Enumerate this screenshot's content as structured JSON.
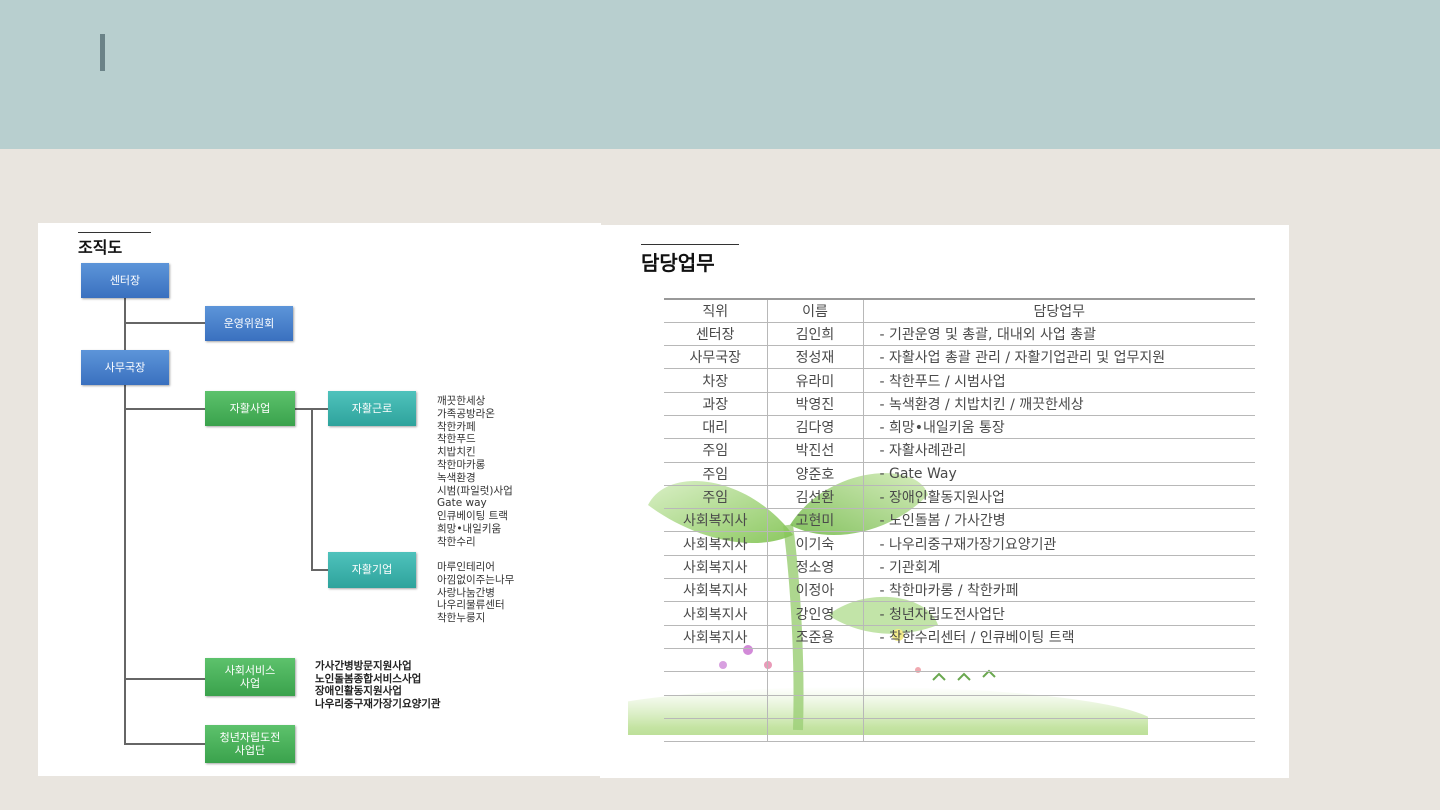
{
  "org": {
    "title": "조직도",
    "nodes": {
      "center_head": "센터장",
      "committee": "운영위원회",
      "secretary_general": "사무국장",
      "self_support": "자활사업",
      "self_work": "자활근로",
      "self_enterprise": "자활기업",
      "social_service": "사회서비스\n사업",
      "youth": "청년자립도전\n사업단"
    },
    "self_work_items": [
      "깨끗한세상",
      "가족공방라온",
      "착한카페",
      "착한푸드",
      "치밥치킨",
      "착한마카롱",
      "녹색환경",
      "시범(파일럿)사업",
      "Gate way",
      "인큐베이팅 트랙",
      "희망•내일키움",
      "착한수리"
    ],
    "enterprise_items": [
      "마루인테리어",
      "아낌없이주는나무",
      "사랑나눔간병",
      "나우리물류센터",
      "착한누룽지"
    ],
    "social_items": [
      "가사간병방문지원사업",
      "노인돌봄종합서비스사업",
      "장애인활동지원사업",
      "나우리중구재가장기요양기관"
    ]
  },
  "duty": {
    "title": "담당업무",
    "headers": [
      "직위",
      "이름",
      "담당업무"
    ],
    "rows": [
      [
        "센터장",
        "김인희",
        "- 기관운영 및 총괄, 대내외 사업 총괄"
      ],
      [
        "사무국장",
        "정성재",
        "- 자활사업 총괄 관리 / 자활기업관리 및 업무지원"
      ],
      [
        "차장",
        "유라미",
        "- 착한푸드 / 시범사업"
      ],
      [
        "과장",
        "박영진",
        "- 녹색환경 / 치밥치킨 / 깨끗한세상"
      ],
      [
        "대리",
        "김다영",
        "- 희망•내일키움 통장"
      ],
      [
        "주임",
        "박진선",
        "- 자활사례관리"
      ],
      [
        "주임",
        "양준호",
        "- Gate Way"
      ],
      [
        "주임",
        "김선환",
        "- 장애인활동지원사업"
      ],
      [
        "사회복지사",
        "고현미",
        "- 노인돌봄 / 가사간병"
      ],
      [
        "사회복지사",
        "이기숙",
        "- 나우리중구재가장기요양기관"
      ],
      [
        "사회복지사",
        "정소영",
        "- 기관회계"
      ],
      [
        "사회복지사",
        "이정아",
        "- 착한마카롱 / 착한카페"
      ],
      [
        "사회복지사",
        "강인영",
        "- 청년자립도전사업단"
      ],
      [
        "사회복지사",
        "조준용",
        "- 착한수리센터 / 인큐베이팅 트랙"
      ],
      [
        "",
        "",
        ""
      ],
      [
        "",
        "",
        ""
      ],
      [
        "",
        "",
        ""
      ],
      [
        "",
        "",
        ""
      ]
    ]
  },
  "colors": {
    "header_band": "#b8cfcf",
    "background": "#e9e5df",
    "box_blue": "#4a82cc",
    "box_green": "#4cb35c",
    "box_teal": "#3cb3ad"
  }
}
